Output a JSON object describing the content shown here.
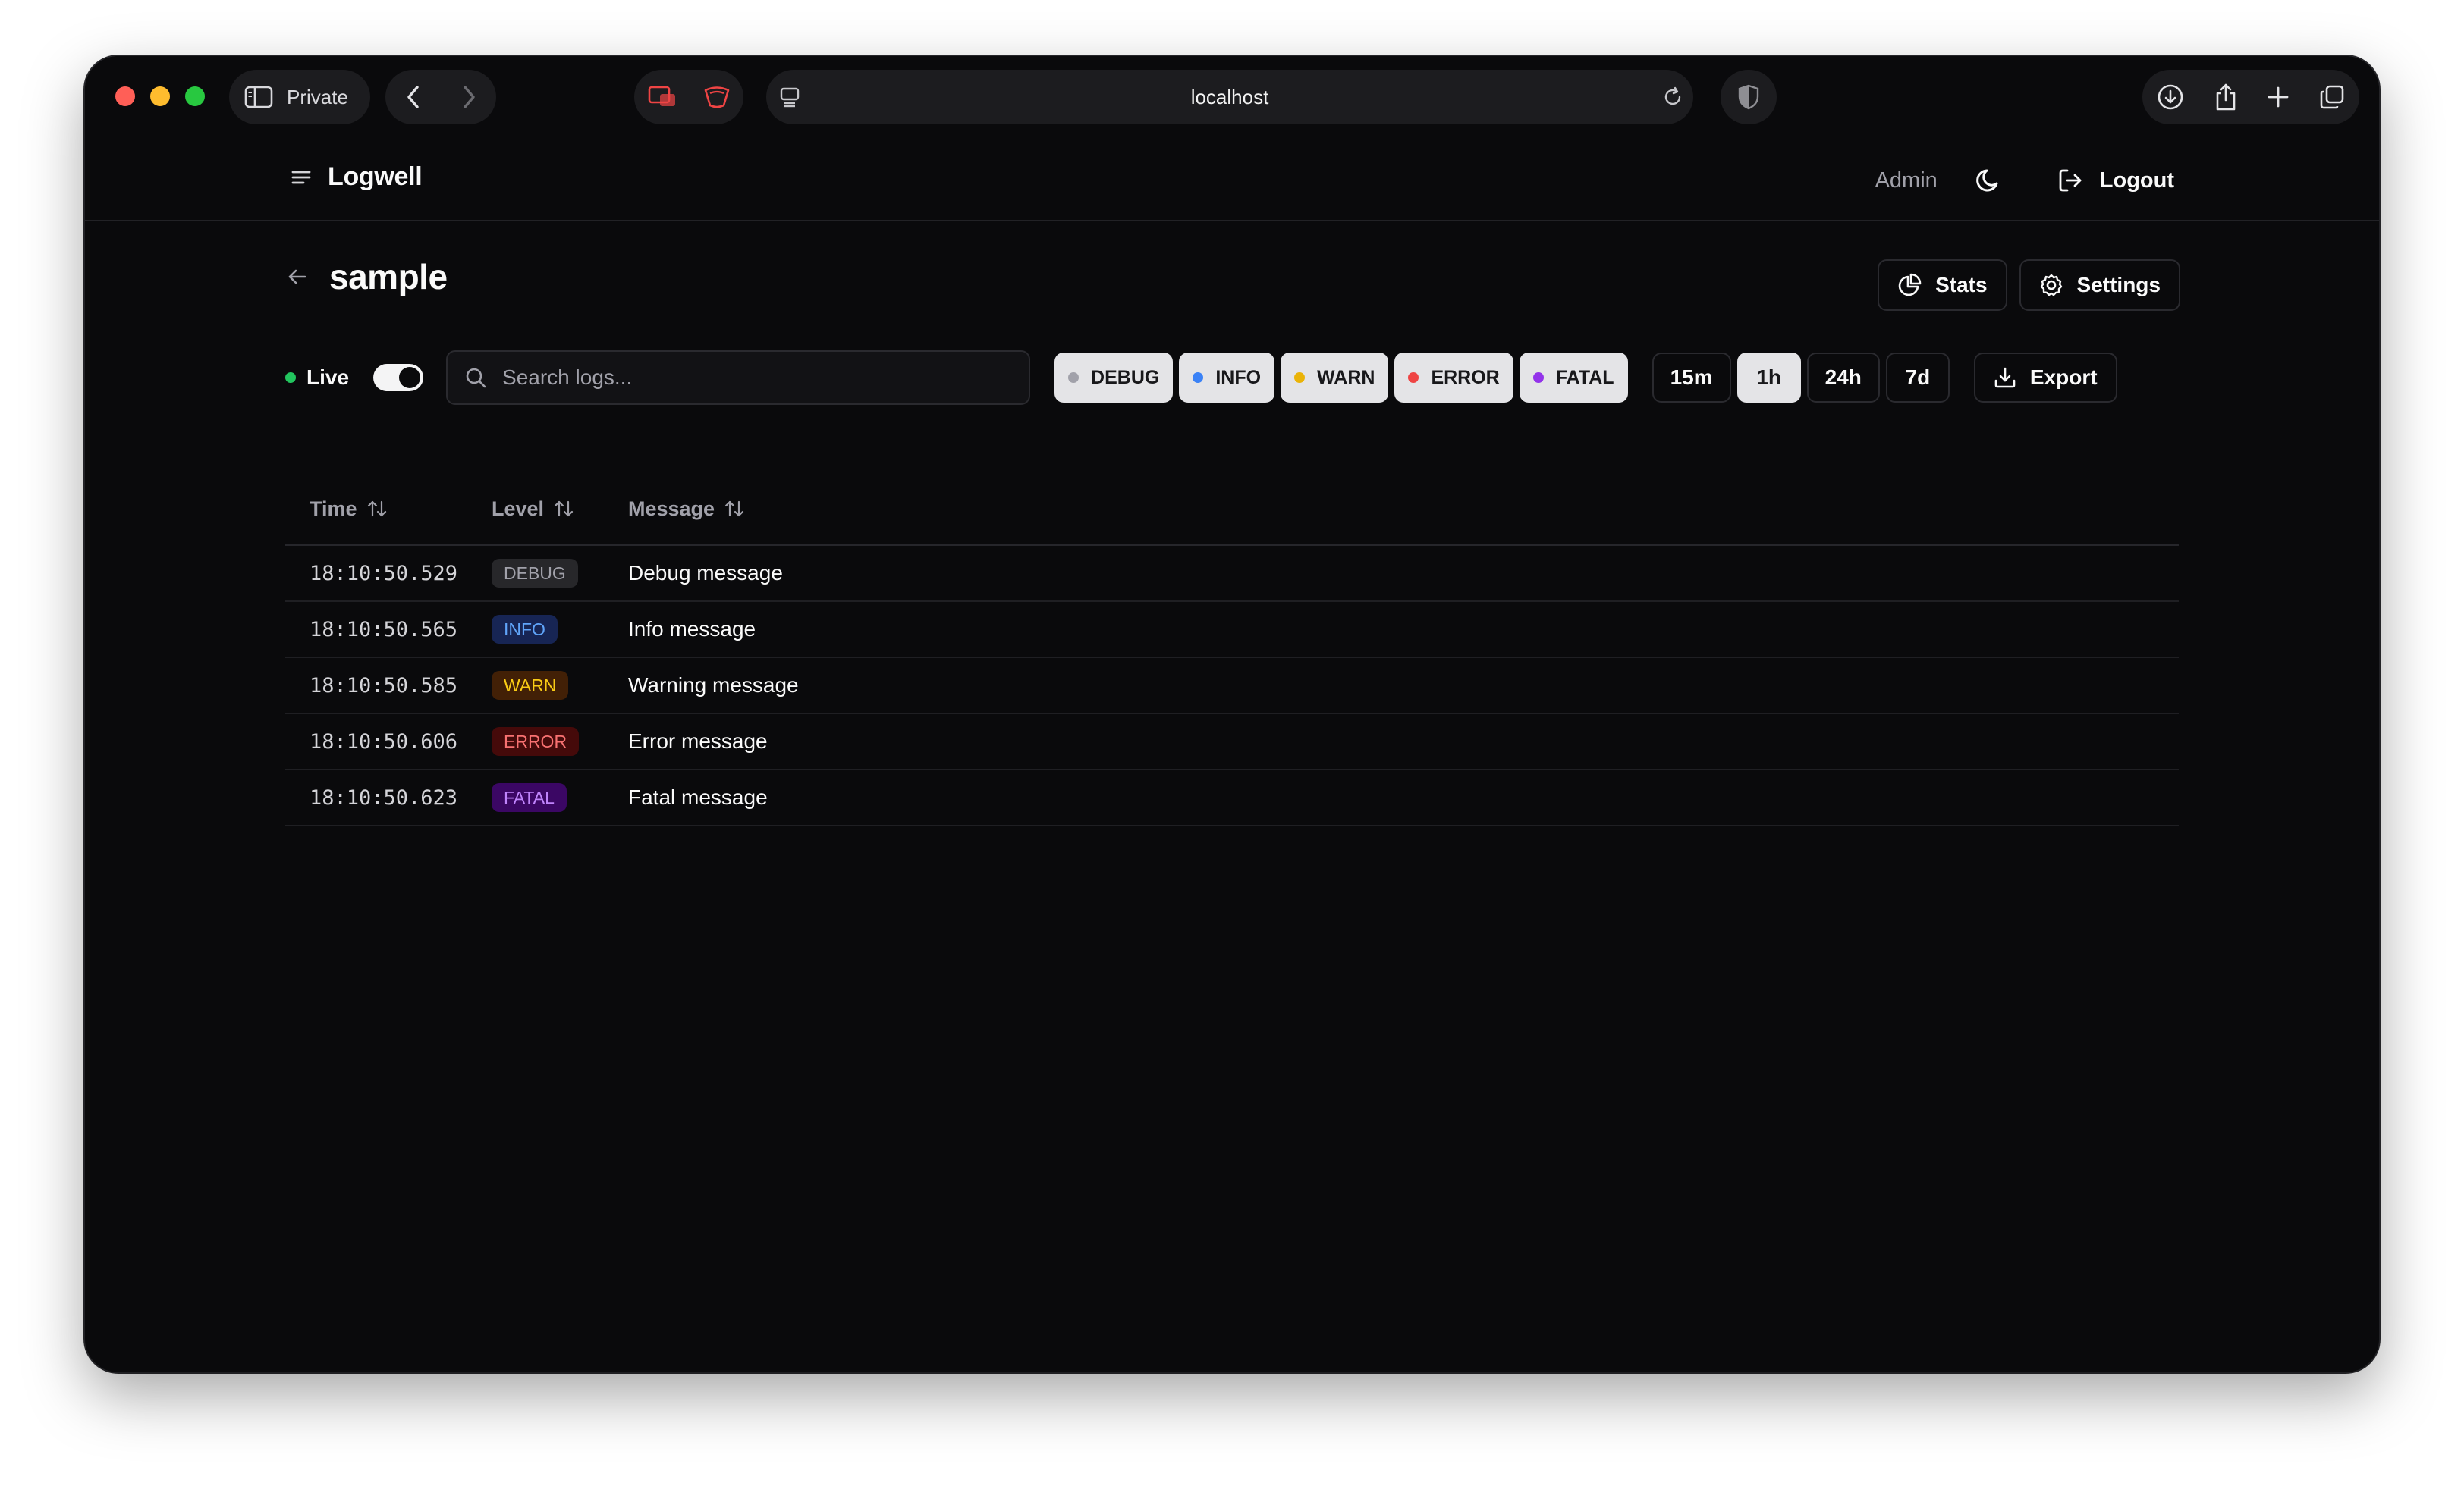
{
  "browser": {
    "private_label": "Private",
    "url": "localhost"
  },
  "app": {
    "brand": "Logwell",
    "user": "Admin",
    "logout_label": "Logout"
  },
  "page": {
    "title": "sample",
    "stats_label": "Stats",
    "settings_label": "Settings"
  },
  "toolbar": {
    "live_label": "Live",
    "live_on": true,
    "search_placeholder": "Search logs...",
    "levels": [
      {
        "label": "DEBUG",
        "color": "#a1a1aa"
      },
      {
        "label": "INFO",
        "color": "#3b82f6"
      },
      {
        "label": "WARN",
        "color": "#eab308"
      },
      {
        "label": "ERROR",
        "color": "#ef4444"
      },
      {
        "label": "FATAL",
        "color": "#9333ea"
      }
    ],
    "ranges": [
      {
        "label": "15m",
        "active": false
      },
      {
        "label": "1h",
        "active": true
      },
      {
        "label": "24h",
        "active": false
      },
      {
        "label": "7d",
        "active": false
      }
    ],
    "export_label": "Export"
  },
  "table": {
    "columns": [
      "Time",
      "Level",
      "Message"
    ],
    "rows": [
      {
        "time": "18:10:50.529",
        "level": "DEBUG",
        "message": "Debug message"
      },
      {
        "time": "18:10:50.565",
        "level": "INFO",
        "message": "Info message"
      },
      {
        "time": "18:10:50.585",
        "level": "WARN",
        "message": "Warning message"
      },
      {
        "time": "18:10:50.606",
        "level": "ERROR",
        "message": "Error message"
      },
      {
        "time": "18:10:50.623",
        "level": "FATAL",
        "message": "Fatal message"
      }
    ]
  },
  "badge_colors": {
    "DEBUG": {
      "bg": "#27272a",
      "fg": "#a1a1aa"
    },
    "INFO": {
      "bg": "#172554",
      "fg": "#60a5fa"
    },
    "WARN": {
      "bg": "#422006",
      "fg": "#facc15"
    },
    "ERROR": {
      "bg": "#450a0a",
      "fg": "#f87171"
    },
    "FATAL": {
      "bg": "#3b0764",
      "fg": "#c084fc"
    }
  }
}
